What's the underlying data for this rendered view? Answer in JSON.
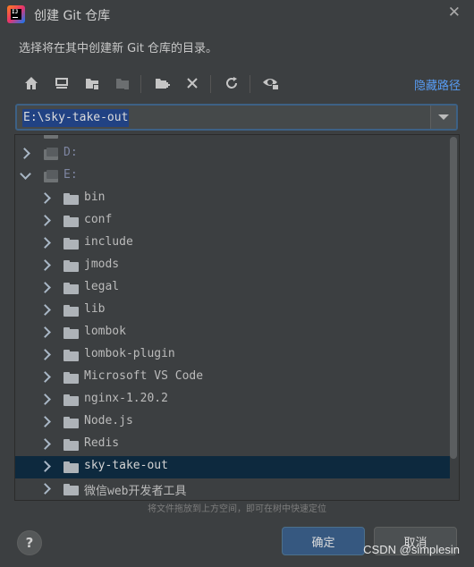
{
  "dialog": {
    "title": "创建 Git 仓库",
    "close_icon": "close-icon",
    "description": "选择将在其中创建新 Git 仓库的目录。"
  },
  "toolbar": {
    "icons": [
      "home-icon",
      "desktop-icon",
      "project-folder-icon",
      "module-folder-icon",
      "new-folder-icon",
      "delete-icon",
      "refresh-icon",
      "show-hidden-icon"
    ],
    "hide_path_label": "隐藏路径"
  },
  "path": {
    "value": "E:\\sky-take-out"
  },
  "tree": {
    "items": [
      {
        "label": "D:"
      },
      {
        "label": "E:"
      },
      {
        "label": "bin"
      },
      {
        "label": "conf"
      },
      {
        "label": "include"
      },
      {
        "label": "jmods"
      },
      {
        "label": "legal"
      },
      {
        "label": "lib"
      },
      {
        "label": "lombok"
      },
      {
        "label": "lombok-plugin"
      },
      {
        "label": "Microsoft VS Code"
      },
      {
        "label": "nginx-1.20.2"
      },
      {
        "label": "Node.js"
      },
      {
        "label": "Redis"
      },
      {
        "label": "sky-take-out"
      },
      {
        "label": "微信web开发者工具"
      }
    ],
    "selected": "sky-take-out"
  },
  "hint": "将文件拖放到上方空间，即可在树中快速定位",
  "footer": {
    "help_label": "?",
    "ok_label": "确定",
    "cancel_label": "取消",
    "watermark": "CSDN @simplesin"
  },
  "colors": {
    "background": "#3c3f41",
    "accent_link": "#589df6",
    "selection": "#0d293e",
    "primary_button": "#365880"
  }
}
